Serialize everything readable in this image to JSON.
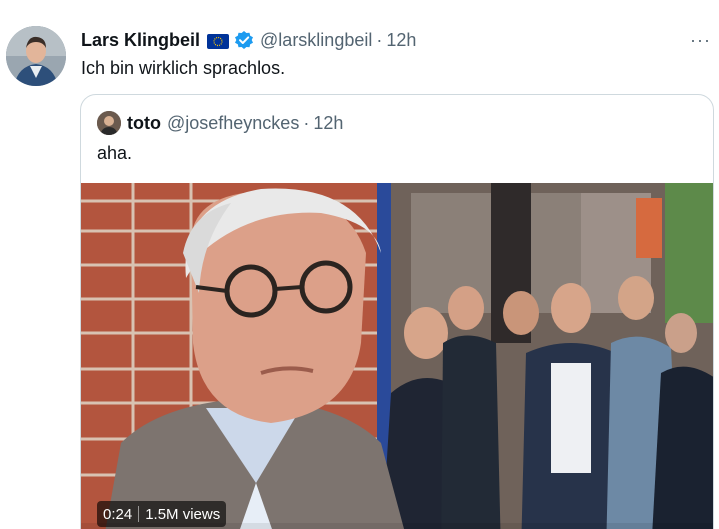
{
  "tweet": {
    "author_name": "Lars Klingbeil",
    "handle": "@larsklingbeil",
    "separator": "·",
    "time": "12h",
    "text": "Ich bin wirklich sprachlos.",
    "more_label": "···",
    "eu_flag_icon": "eu-flag-icon",
    "verified_icon": "verified-badge-icon"
  },
  "quote": {
    "author_name": "toto",
    "handle": "@josefheynckes",
    "separator": "·",
    "time": "12h",
    "text": "aha.",
    "video": {
      "duration": "0:24",
      "views": "1.5M views"
    }
  },
  "colors": {
    "text_primary": "#0f1419",
    "text_secondary": "#536471",
    "verified_blue": "#1d9bf0",
    "eu_blue": "#003399",
    "border": "#cfd9de"
  }
}
